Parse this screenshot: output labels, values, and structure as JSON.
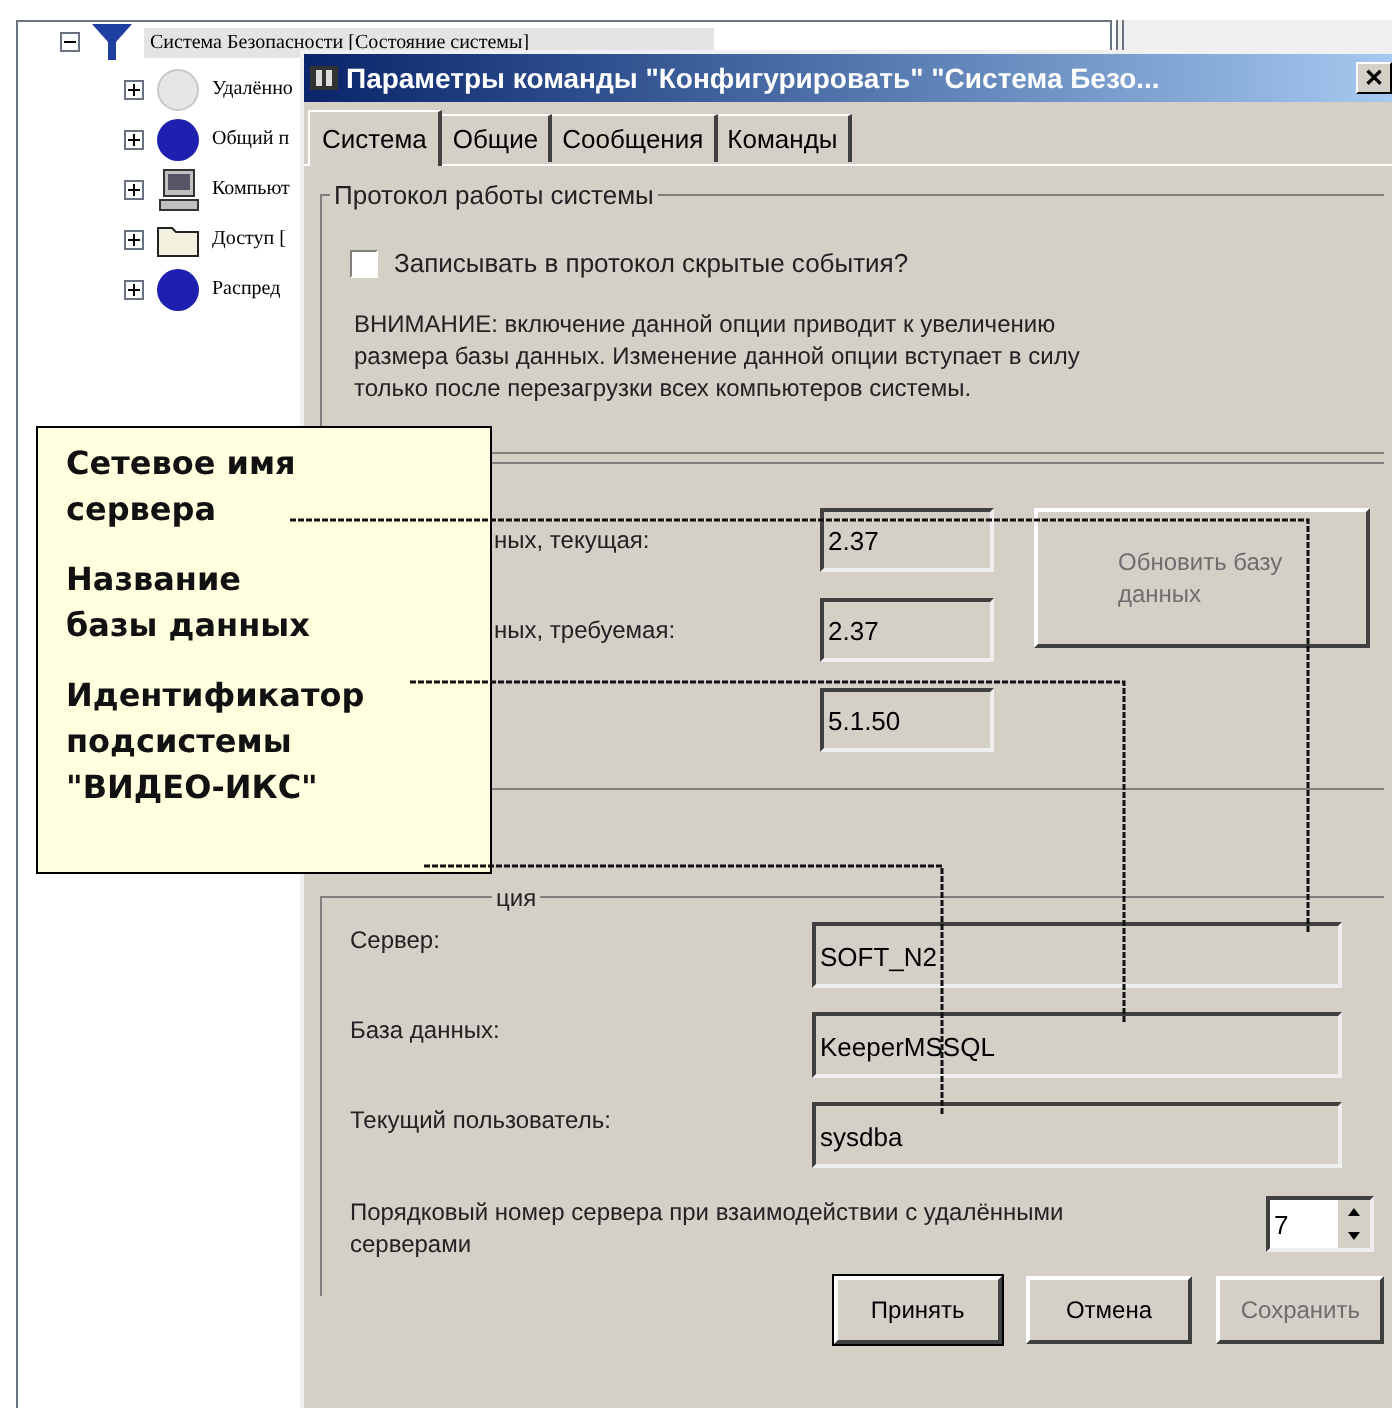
{
  "tree": {
    "label": "Система Безопасности [Состояние системы]",
    "selected": true,
    "expanded": true,
    "children": [
      {
        "label": "Удалённо",
        "kind": "disabled-circle",
        "expanded": false
      },
      {
        "label": "Общий п",
        "kind": "circle",
        "expanded": false
      },
      {
        "label": "Компьют",
        "kind": "computer",
        "expanded": false
      },
      {
        "label": "Доступ [",
        "kind": "folder",
        "expanded": false
      },
      {
        "label": "Распред",
        "kind": "circle",
        "expanded": false
      }
    ]
  },
  "dialog": {
    "title": "Параметры команды \"Конфигурировать\" \"Система Безо...",
    "close": "✕",
    "tabs": [
      {
        "label": "Система",
        "selected": true
      },
      {
        "label": "Общие",
        "selected": false
      },
      {
        "label": "Сообщения",
        "selected": false
      },
      {
        "label": "Команды",
        "selected": false
      }
    ],
    "log_group": {
      "title": "Протокол работы системы",
      "checkbox": {
        "label": "Записывать в протокол скрытые события?",
        "checked": false
      },
      "warning": "ВНИМАНИЕ: включение данной опции приводит к увеличению\nразмера базы данных. Изменение данной опции вступает в  силу\nтолько после перезагрузки всех компьютеров системы."
    },
    "version_group": {
      "rows": [
        {
          "label": "ных, текущая:",
          "value": "2.37"
        },
        {
          "label": "ных, требуемая:",
          "value": "2.37"
        },
        {
          "value": "5.1.50"
        }
      ],
      "update_button": {
        "label": "Обновить базу данных",
        "disabled": true
      }
    },
    "connection_group": {
      "title": "ция",
      "fields": [
        {
          "label": "Сервер:",
          "value": "SOFT_N2"
        },
        {
          "label": "База данных:",
          "value": "KeeperMSSQL"
        },
        {
          "label": "Текущий пользователь:",
          "value": "sysdba"
        }
      ],
      "server_number": {
        "label": "Порядковый номер сервера при взаимодействии с удалёнными серверами",
        "value": "7"
      }
    },
    "buttons": [
      {
        "label": "Принять",
        "disabled": false
      },
      {
        "label": "Отмена",
        "disabled": false
      },
      {
        "label": "Сохранить",
        "disabled": true
      }
    ]
  },
  "callout": {
    "items": [
      "Сетевое имя\nсервера",
      "Название\nбазы данных",
      "Идентификатор\nподсистемы\n\"ВИДЕО-ИКС\""
    ]
  }
}
